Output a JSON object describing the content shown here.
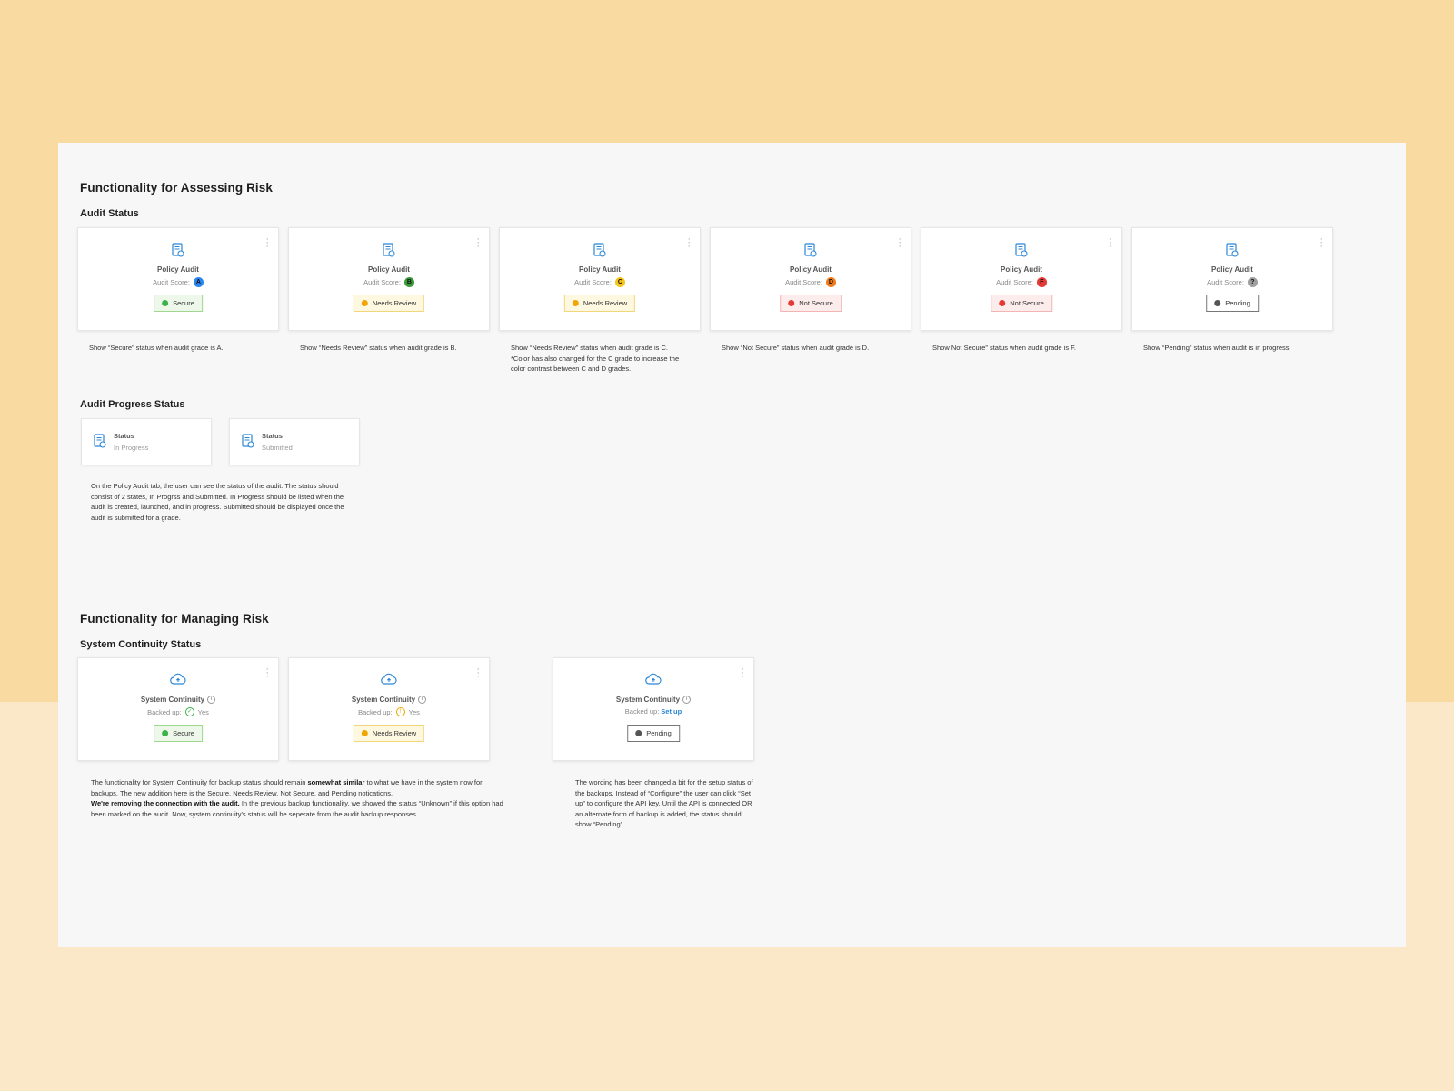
{
  "assess": {
    "title": "Functionality for Assessing Risk",
    "audit_status_title": "Audit Status",
    "cards": [
      {
        "title": "Policy Audit",
        "score_label": "Audit Score:",
        "grade": "A",
        "grade_color": "#2a86f0",
        "status": "Secure",
        "status_dot": "#3bb24a",
        "status_bg": "#eef8ea",
        "status_border": "#9fd78e",
        "note": "Show “Secure” status when audit grade is A.",
        "note2": ""
      },
      {
        "title": "Policy Audit",
        "score_label": "Audit Score:",
        "grade": "B",
        "grade_color": "#3b9a3b",
        "status": "Needs Review",
        "status_dot": "#f0a500",
        "status_bg": "#fff8e1",
        "status_border": "#f2d77a",
        "note": "Show “Needs Review” status when audit grade is B.",
        "note2": ""
      },
      {
        "title": "Policy Audit",
        "score_label": "Audit Score:",
        "grade": "C",
        "grade_color": "#f5c31a",
        "status": "Needs Review",
        "status_dot": "#f0a500",
        "status_bg": "#fff8e1",
        "status_border": "#f2d77a",
        "note": "Show “Needs Review” status when audit grade is C.",
        "note2": "*Color has also changed for the C grade to increase the color contrast between C and D grades."
      },
      {
        "title": "Policy Audit",
        "score_label": "Audit Score:",
        "grade": "D",
        "grade_color": "#f07a1a",
        "status": "Not Secure",
        "status_dot": "#e53935",
        "status_bg": "#fdecec",
        "status_border": "#f5b4b4",
        "note": "Show “Not Secure” status when audit grade is D.",
        "note2": ""
      },
      {
        "title": "Policy Audit",
        "score_label": "Audit Score:",
        "grade": "F",
        "grade_color": "#e53935",
        "status": "Not Secure",
        "status_dot": "#e53935",
        "status_bg": "#fdecec",
        "status_border": "#f5b4b4",
        "note": "Show Not Secure” status when audit grade is F.",
        "note2": ""
      },
      {
        "title": "Policy Audit",
        "score_label": "Audit Score:",
        "grade": "?",
        "grade_color": "#9e9e9e",
        "status": "Pending",
        "status_dot": "#555555",
        "status_bg": "#ffffff",
        "status_border": "#777777",
        "note": "Show “Pending” status when audit is in progress.",
        "note2": ""
      }
    ],
    "progress_title": "Audit Progress Status",
    "progress_cards": [
      {
        "label": "Status",
        "value": "In Progress"
      },
      {
        "label": "Status",
        "value": "Submitted"
      }
    ],
    "progress_note": "On the Policy Audit tab, the user can see the status of the audit. The status should consist of 2 states, In Progrss and Submitted. In Progress should be listed when the audit is created, launched, and in progress. Submitted should be displayed once the audit is submitted for a grade."
  },
  "manage": {
    "title": "Functionality for Managing Risk",
    "continuity_title": "System Continuity Status",
    "cards": [
      {
        "title": "System Continuity",
        "backed_label": "Backed up:",
        "backed_value": "Yes",
        "status": "Secure",
        "status_dot": "#3bb24a",
        "status_bg": "#eef8ea",
        "status_border": "#9fd78e"
      },
      {
        "title": "System Continuity",
        "backed_label": "Backed up:",
        "backed_value": "Yes",
        "status": "Needs Review",
        "status_dot": "#f0a500",
        "status_bg": "#fff8e1",
        "status_border": "#f2d77a"
      },
      {
        "title": "System Continuity",
        "backed_label": "Backed up:",
        "backed_value": "Set up",
        "status": "Pending",
        "status_dot": "#555555",
        "status_bg": "#ffffff",
        "status_border": "#777777"
      }
    ],
    "note_left_1": "The functionality for System Continuity for backup status should remain ",
    "note_left_bold": "somewhat similar",
    "note_left_2": " to what we have in the system now for backups. The new addition here is the Secure, Needs Review, Not Secure, and Pending notications.",
    "note_left_bold2": "We're removing the connection with the audit.",
    "note_left_3": " In the previous backup functionality, we showed the status “Unknown” if this option had been marked on the audit. Now, system continuity's status will be seperate from the audit backup responses.",
    "note_right": "The wording has been changed a bit for the setup status of the backups. Instead of “Configure” the user can click “Set up” to configure the API key. Until the API is connected OR an alternate form of backup is added, the status should show “Pending”."
  },
  "colors": {
    "accent": "#2a86d6",
    "page_bg": "#f7f7f7",
    "outer_bg": "#f9dba1"
  }
}
